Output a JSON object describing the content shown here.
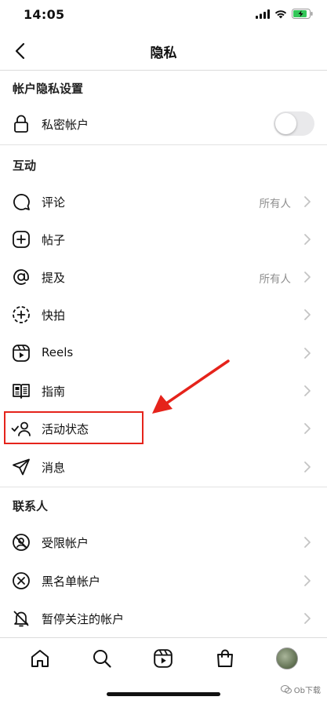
{
  "status_bar": {
    "time": "14:05"
  },
  "header": {
    "title": "隐私"
  },
  "sections": {
    "account_privacy": {
      "title": "帐户隐私设置",
      "private_account_label": "私密帐户",
      "private_account_on": false
    },
    "interactions": {
      "title": "互动",
      "items": [
        {
          "label": "评论",
          "value": "所有人",
          "icon": "comment-icon"
        },
        {
          "label": "帖子",
          "value": "",
          "icon": "plus-square-icon"
        },
        {
          "label": "提及",
          "value": "所有人",
          "icon": "at-icon"
        },
        {
          "label": "快拍",
          "value": "",
          "icon": "story-plus-icon"
        },
        {
          "label": "Reels",
          "value": "",
          "icon": "reels-icon"
        },
        {
          "label": "指南",
          "value": "",
          "icon": "guide-book-icon"
        },
        {
          "label": "活动状态",
          "value": "",
          "icon": "activity-status-icon"
        },
        {
          "label": "消息",
          "value": "",
          "icon": "send-icon"
        }
      ]
    },
    "connections": {
      "title": "联系人",
      "items": [
        {
          "label": "受限帐户",
          "icon": "restricted-icon"
        },
        {
          "label": "黑名单帐户",
          "icon": "blocked-icon"
        },
        {
          "label": "暂停关注的帐户",
          "icon": "muted-bell-icon"
        }
      ]
    }
  },
  "tab_bar": {
    "tabs": [
      "home-icon",
      "search-icon",
      "reels-icon",
      "shop-icon",
      "avatar"
    ]
  },
  "watermark": {
    "text": "Ob下载"
  },
  "colors": {
    "highlight": "#e5231b",
    "secondary_text": "#8e8e8e",
    "toggle_off": "#e9e9eb"
  }
}
